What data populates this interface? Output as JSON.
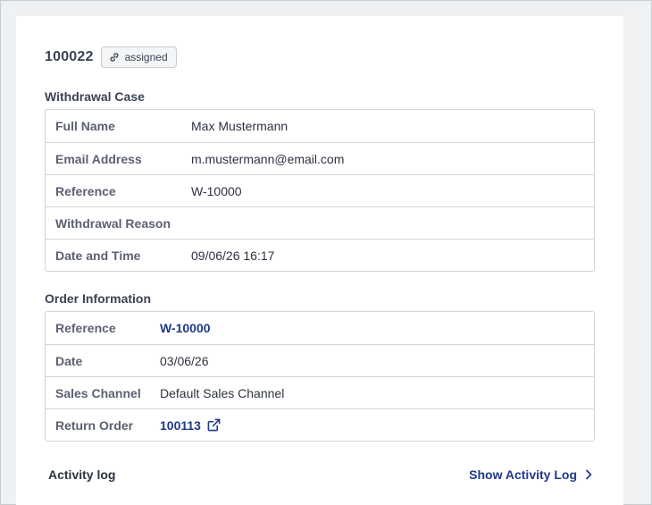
{
  "case": {
    "id": "100022",
    "status_badge": "assigned",
    "badge_icon": "link-icon"
  },
  "withdrawal_case": {
    "title": "Withdrawal Case",
    "rows": [
      {
        "label": "Full Name",
        "value": "Max Mustermann"
      },
      {
        "label": "Email Address",
        "value": "m.mustermann@email.com"
      },
      {
        "label": "Reference",
        "value": "W-10000"
      },
      {
        "label": "Withdrawal Reason",
        "value": ""
      },
      {
        "label": "Date and Time",
        "value": "09/06/26 16:17"
      }
    ]
  },
  "order_information": {
    "title": "Order Information",
    "rows": [
      {
        "label": "Reference",
        "value": "W-10000"
      },
      {
        "label": "Date",
        "value": "03/06/26"
      },
      {
        "label": "Sales Channel",
        "value": "Default Sales Channel"
      },
      {
        "label": "Return Order",
        "value": "100113"
      }
    ],
    "return_order_icon": "external-link-icon"
  },
  "activity": {
    "label": "Activity log",
    "link_label": "Show Activity Log",
    "link_icon": "chevron-right-icon"
  },
  "colors": {
    "link": "#1f3a8a",
    "background": "#f0f1f3",
    "card": "#ffffff",
    "border": "#d1d5db"
  }
}
